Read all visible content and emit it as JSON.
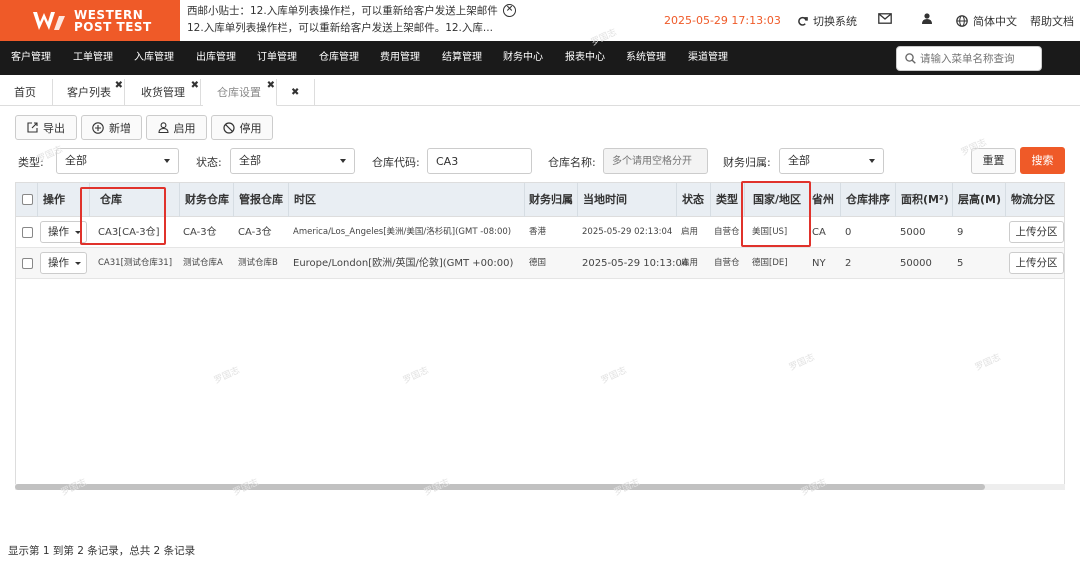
{
  "brand": {
    "line1": "WESTERN",
    "line2": "POST TEST",
    "color": "#ef5a28"
  },
  "tip": {
    "line1": "西邮小贴士：12.入库单列表操作栏，可以重新给客户发送上架邮件",
    "line2": "12.入库单列表操作栏，可以重新给客户发送上架邮件。12.入库..."
  },
  "clock": "2025-05-29 17:13:03",
  "top_actions": {
    "switch_system": "切换系统",
    "language": "简体中文",
    "help": "帮助文档"
  },
  "nav": [
    "客户管理",
    "工单管理",
    "入库管理",
    "出库管理",
    "订单管理",
    "仓库管理",
    "费用管理",
    "结算管理",
    "财务中心",
    "报表中心",
    "系统管理",
    "渠道管理"
  ],
  "menu_search": {
    "placeholder": "请输入菜单名称查询"
  },
  "tabs": [
    {
      "label": "首页",
      "closable": false
    },
    {
      "label": "客户列表",
      "closable": true
    },
    {
      "label": "收货管理",
      "closable": true
    },
    {
      "label": "仓库设置",
      "closable": true,
      "active": true
    }
  ],
  "toolbar": {
    "export": "导出",
    "add": "新增",
    "enable": "启用",
    "disable": "停用"
  },
  "filters": {
    "type_label": "类型:",
    "type_value": "全部",
    "status_label": "状态:",
    "status_value": "全部",
    "code_label": "仓库代码:",
    "code_value": "CA3",
    "name_label": "仓库名称:",
    "name_placeholder": "多个请用空格分开",
    "finance_label": "财务归属:",
    "finance_value": "全部",
    "reset": "重置",
    "search": "搜索"
  },
  "table": {
    "columns": [
      "操作",
      "仓库",
      "财务仓库",
      "管报仓库",
      "时区",
      "财务归属",
      "当地时间",
      "状态",
      "类型",
      "国家/地区",
      "省州",
      "仓库排序",
      "面积(M²)",
      "层高(M)",
      "物流分区"
    ],
    "rows": [
      {
        "op": "操作",
        "warehouse": "CA3[CA-3仓]",
        "finance_wh": "CA-3仓",
        "report_wh": "CA-3仓",
        "timezone": "America/Los_Angeles[美洲/美国/洛杉矶](GMT -08:00)",
        "finance_owner": "香港",
        "local_time": "2025-05-29 02:13:04",
        "status": "启用",
        "type": "自营仓",
        "country": "美国[US]",
        "province": "CA",
        "sort": "0",
        "area": "5000",
        "height": "9",
        "upload": "上传分区"
      },
      {
        "op": "操作",
        "warehouse": "CA31[测试仓库31]",
        "finance_wh": "测试仓库A",
        "report_wh": "测试仓库B",
        "timezone": "Europe/London[欧洲/英国/伦敦](GMT +00:00)",
        "finance_owner": "德国",
        "local_time": "2025-05-29 10:13:04",
        "status": "启用",
        "type": "自营仓",
        "country": "德国[DE]",
        "province": "NY",
        "sort": "2",
        "area": "50000",
        "height": "5",
        "upload": "上传分区"
      }
    ]
  },
  "footer": "显示第 1 到第 2 条记录，总共 2 条记录",
  "watermark": "罗国志",
  "colors": {
    "accent": "#ef5a28",
    "nav_bg": "#1a1a1a",
    "highlight": "#e0322b"
  }
}
